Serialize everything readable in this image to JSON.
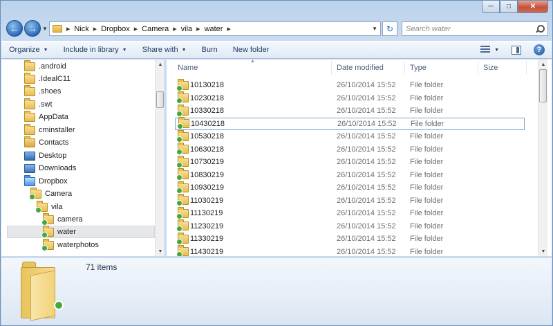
{
  "window": {
    "caption_buttons": [
      "minimize-icon",
      "maximize-icon",
      "close-icon"
    ]
  },
  "nav": {
    "back_icon": "back-arrow-icon",
    "forward_icon": "forward-arrow-icon"
  },
  "address": {
    "crumbs": [
      "Nick",
      "Dropbox",
      "Camera",
      "vila",
      "water"
    ]
  },
  "search": {
    "placeholder": "Search water"
  },
  "cmdbar": {
    "organize": "Organize",
    "include": "Include in library",
    "share": "Share with",
    "burn": "Burn",
    "new_folder": "New folder"
  },
  "tree": [
    {
      "label": ".android",
      "icon": "folder"
    },
    {
      "label": ".IdealC11",
      "icon": "folder"
    },
    {
      "label": ".shoes",
      "icon": "folder"
    },
    {
      "label": ".swt",
      "icon": "folder"
    },
    {
      "label": "AppData",
      "icon": "folder"
    },
    {
      "label": "cminstaller",
      "icon": "folder"
    },
    {
      "label": "Contacts",
      "icon": "folder"
    },
    {
      "label": "Desktop",
      "icon": "desktop"
    },
    {
      "label": "Downloads",
      "icon": "downloads"
    },
    {
      "label": "Dropbox",
      "icon": "dropbox"
    },
    {
      "label": "Camera",
      "icon": "dropbox-folder"
    },
    {
      "label": "vila",
      "icon": "dropbox-folder"
    },
    {
      "label": "camera",
      "icon": "dropbox-folder"
    },
    {
      "label": "water",
      "icon": "dropbox-folder",
      "selected": true
    },
    {
      "label": "waterphotos",
      "icon": "dropbox-folder"
    }
  ],
  "columns": {
    "name": "Name",
    "date": "Date modified",
    "type": "Type",
    "size": "Size"
  },
  "files": [
    {
      "name": "10130218",
      "date": "26/10/2014 15:52",
      "type": "File folder"
    },
    {
      "name": "10230218",
      "date": "26/10/2014 15:52",
      "type": "File folder"
    },
    {
      "name": "10330218",
      "date": "26/10/2014 15:52",
      "type": "File folder"
    },
    {
      "name": "10430218",
      "date": "26/10/2014 15:52",
      "type": "File folder"
    },
    {
      "name": "10530218",
      "date": "26/10/2014 15:52",
      "type": "File folder"
    },
    {
      "name": "10630218",
      "date": "26/10/2014 15:52",
      "type": "File folder"
    },
    {
      "name": "10730219",
      "date": "26/10/2014 15:52",
      "type": "File folder"
    },
    {
      "name": "10830219",
      "date": "26/10/2014 15:52",
      "type": "File folder"
    },
    {
      "name": "10930219",
      "date": "26/10/2014 15:52",
      "type": "File folder"
    },
    {
      "name": "11030219",
      "date": "26/10/2014 15:52",
      "type": "File folder"
    },
    {
      "name": "11130219",
      "date": "26/10/2014 15:52",
      "type": "File folder"
    },
    {
      "name": "11230219",
      "date": "26/10/2014 15:52",
      "type": "File folder"
    },
    {
      "name": "11330219",
      "date": "26/10/2014 15:52",
      "type": "File folder"
    },
    {
      "name": "11430219",
      "date": "26/10/2014 15:52",
      "type": "File folder"
    }
  ],
  "focused_file_index": 3,
  "details": {
    "item_count": "71 items"
  }
}
